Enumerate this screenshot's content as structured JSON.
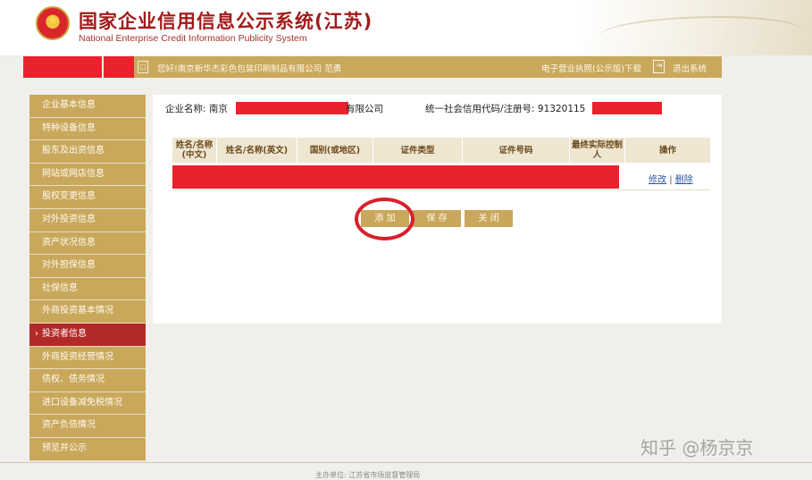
{
  "header": {
    "title": "国家企业信用信息公示系统(江苏)",
    "subtitle": "National Enterprise Credit Information Publicity System"
  },
  "topbar": {
    "greeting": "您好!南京新华杰彩色包装印刷制品有限公司   范勇",
    "license_link": "电子营业执照(公示版)下载",
    "logout": "退出系统"
  },
  "sidebar": {
    "items": [
      {
        "label": "企业基本信息"
      },
      {
        "label": "特种设备信息"
      },
      {
        "label": "股东及出资信息"
      },
      {
        "label": "网站或网店信息"
      },
      {
        "label": "股权变更信息"
      },
      {
        "label": "对外投资信息"
      },
      {
        "label": "资产状况信息"
      },
      {
        "label": "对外担保信息"
      },
      {
        "label": "社保信息"
      },
      {
        "label": "外商投资基本情况"
      },
      {
        "label": "投资者信息",
        "active": true
      },
      {
        "label": "外商投资经营情况"
      },
      {
        "label": "债权、债务情况"
      },
      {
        "label": "进口设备减免税情况"
      },
      {
        "label": "资产负债情况"
      },
      {
        "label": "预览并公示"
      }
    ]
  },
  "main": {
    "company_label": "企业名称: 南京",
    "company_suffix": "有限公司",
    "code_label": "统一社会信用代码/注册号: 91320115",
    "table": {
      "headers": [
        "姓名/名称(中文)",
        "姓名/名称(英文)",
        "国别(或地区)",
        "证件类型",
        "证件号码",
        "最终实际控制人",
        "操作"
      ],
      "row_actions": {
        "edit": "修改",
        "separator": "|",
        "delete": "删除"
      }
    },
    "buttons": {
      "add": "添 加",
      "save": "保 存",
      "close": "关 闭"
    }
  },
  "footer": {
    "text": "主办单位: 江苏省市场监督管理局"
  },
  "watermark": "知乎 @杨京京",
  "colors": {
    "accent_gold": "#c9a85c",
    "active_red": "#b22a28",
    "title_red": "#a21a1a",
    "redaction": "#e8232e"
  }
}
